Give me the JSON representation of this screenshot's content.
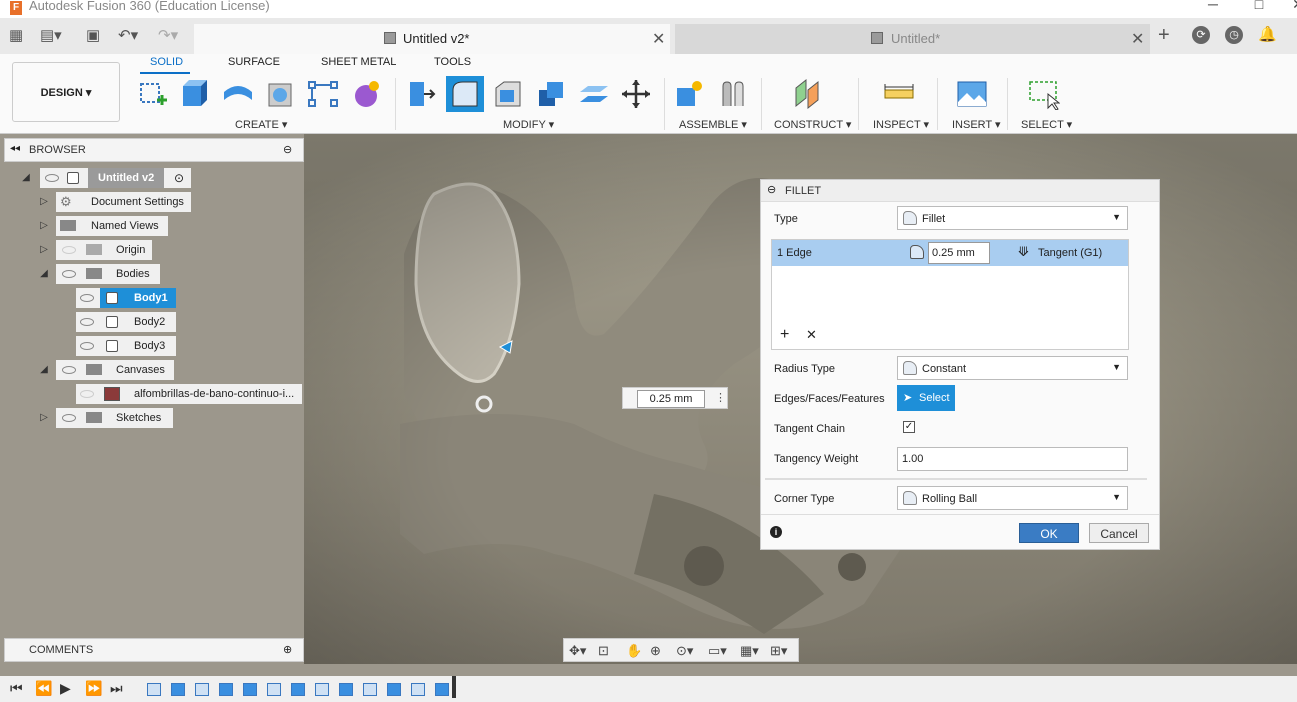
{
  "window": {
    "title": "Autodesk Fusion 360 (Education License)",
    "app_letter": "F"
  },
  "tabs": [
    {
      "label": "Untitled v2*",
      "active": true
    },
    {
      "label": "Untitled*",
      "active": false
    }
  ],
  "toolbar": {
    "workspace": "DESIGN",
    "workspace_tabs": [
      "SOLID",
      "SURFACE",
      "SHEET METAL",
      "TOOLS"
    ],
    "groups": [
      "CREATE",
      "MODIFY",
      "ASSEMBLE",
      "CONSTRUCT",
      "INSPECT",
      "INSERT",
      "SELECT"
    ]
  },
  "browser": {
    "title": "BROWSER",
    "nodes": {
      "root": "Untitled v2",
      "doc_settings": "Document Settings",
      "named_views": "Named Views",
      "origin": "Origin",
      "bodies": "Bodies",
      "body1": "Body1",
      "body2": "Body2",
      "body3": "Body3",
      "canvases": "Canvases",
      "canvas_item": "alfombrillas-de-bano-continuo-i...",
      "sketches": "Sketches"
    }
  },
  "comments": {
    "title": "COMMENTS"
  },
  "viewport": {
    "float_value": "0.25 mm"
  },
  "fillet": {
    "title": "FILLET",
    "type_label": "Type",
    "type_value": "Fillet",
    "edge_label": "1 Edge",
    "edge_radius": "0.25 mm",
    "edge_continuity": "Tangent (G1)",
    "radius_type_label": "Radius Type",
    "radius_type_value": "Constant",
    "edges_label": "Edges/Faces/Features",
    "select_label": "Select",
    "tangent_chain_label": "Tangent Chain",
    "tangent_chain_checked": true,
    "tangency_weight_label": "Tangency Weight",
    "tangency_weight_value": "1.00",
    "corner_type_label": "Corner Type",
    "corner_type_value": "Rolling Ball",
    "ok_label": "OK",
    "cancel_label": "Cancel"
  }
}
